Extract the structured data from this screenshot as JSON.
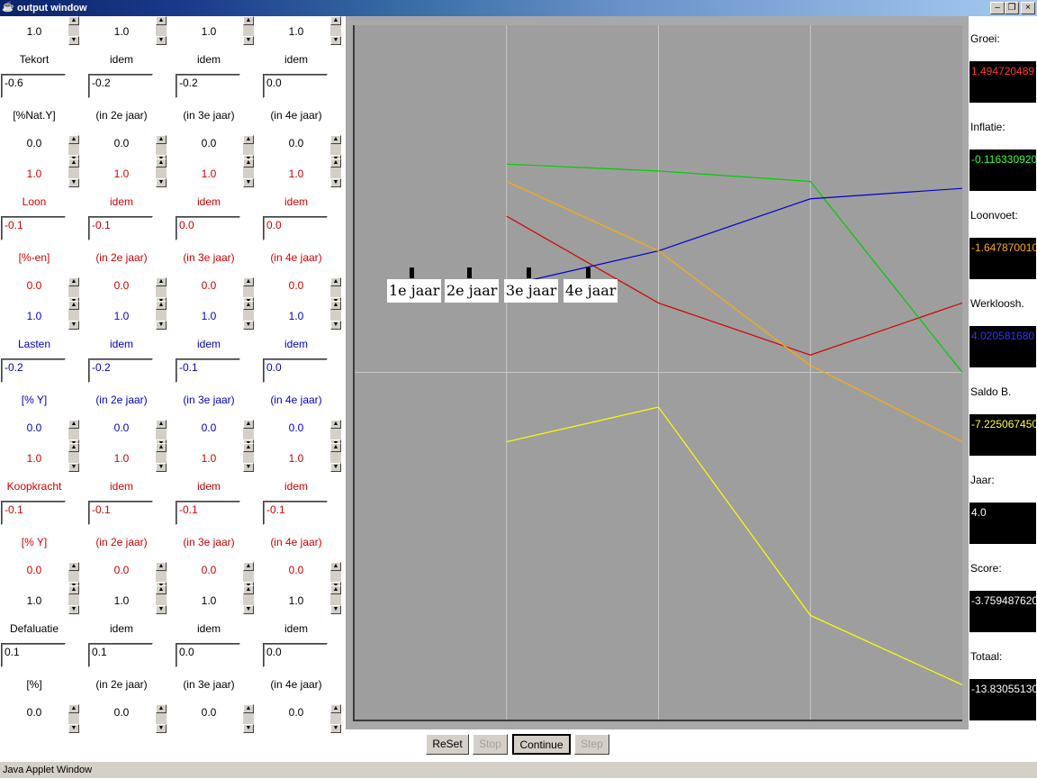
{
  "window": {
    "title": "output window",
    "status": "Java Applet Window"
  },
  "colors": {
    "black": "#000000",
    "red": "#d40000",
    "blue": "#0000cc",
    "green": "#00cc00",
    "orange": "#ffaa00",
    "yellow": "#ffff00",
    "white": "#ffffff"
  },
  "columns": [
    {
      "rows": [
        "1.0",
        "Tekort",
        "-0.6",
        "[%Nat.Y]",
        "0.0",
        "1.0",
        "Loon",
        "-0.1",
        "[%-en]",
        "0.0",
        "1.0",
        "Lasten",
        "-0.2",
        "[% Y]",
        "0.0",
        "1.0",
        "Koopkracht",
        "-0.1",
        "[% Y]",
        "0.0",
        "1.0",
        "Defaluatie",
        "0.1",
        "[%]",
        "0.0"
      ]
    },
    {
      "rows": [
        "1.0",
        "idem",
        "-0.2",
        "(in 2e jaar)",
        "0.0",
        "1.0",
        "idem",
        "-0.1",
        "(in 2e jaar)",
        "0.0",
        "1.0",
        "idem",
        "-0.2",
        "(in 2e jaar)",
        "0.0",
        "1.0",
        "idem",
        "-0.1",
        "(in 2e jaar)",
        "0.0",
        "1.0",
        "idem",
        "0.1",
        "(in 2e jaar)",
        "0.0"
      ]
    },
    {
      "rows": [
        "1.0",
        "idem",
        "-0.2",
        "(in 3e jaar)",
        "0.0",
        "1.0",
        "idem",
        "0.0",
        "(in 3e jaar)",
        "0.0",
        "1.0",
        "idem",
        "-0.1",
        "(in 3e jaar)",
        "0.0",
        "1.0",
        "idem",
        "-0.1",
        "(in 3e jaar)",
        "0.0",
        "1.0",
        "idem",
        "0.0",
        "(in 3e jaar)",
        "0.0"
      ]
    },
    {
      "rows": [
        "1.0",
        "idem",
        "0.0",
        "(in 4e jaar)",
        "0.0",
        "1.0",
        "idem",
        "0.0",
        "(in 4e jaar)",
        "0.0",
        "1.0",
        "idem",
        "0.0",
        "(in 4e jaar)",
        "0.0",
        "1.0",
        "idem",
        "-0.1",
        "(in 4e jaar)",
        "0.0",
        "1.0",
        "idem",
        "0.0",
        "(in 4e jaar)",
        "0.0"
      ]
    }
  ],
  "group_colors": [
    "black",
    "red",
    "blue",
    "red",
    "black"
  ],
  "chart_data": {
    "type": "line",
    "x": [
      "1e jaar",
      "2e jaar",
      "3e jaar",
      "4e jaar"
    ],
    "series": [
      {
        "color": "#d40000",
        "values": [
          0.45,
          0.2,
          0.05,
          0.2
        ]
      },
      {
        "color": "#00cc00",
        "values": [
          0.6,
          0.58,
          0.55,
          0.0
        ]
      },
      {
        "color": "#0000cc",
        "values": [
          0.25,
          0.35,
          0.5,
          0.53
        ]
      },
      {
        "color": "#ffaa00",
        "values": [
          0.55,
          0.35,
          0.02,
          -0.2
        ]
      },
      {
        "color": "#ffff00",
        "values": [
          -0.2,
          -0.1,
          -0.7,
          -0.9
        ]
      }
    ],
    "xlabel": "",
    "ylabel": ""
  },
  "legend_labels": [
    "1e jaar",
    "2e jaar",
    "3e jaar",
    "4e jaar"
  ],
  "readouts": [
    {
      "label": "Groei:",
      "value": "1.494720489",
      "color": "#ff3333"
    },
    {
      "label": "Inflatie:",
      "value": "-0.116330920",
      "color": "#33ff33"
    },
    {
      "label": "Loonvoet:",
      "value": "-1.647870010",
      "color": "#ffaa00"
    },
    {
      "label": "Werkloosh.",
      "value": "4.020581680",
      "color": "#3333ff"
    },
    {
      "label": "Saldo B.",
      "value": "-7.225067450",
      "color": "#ffff33"
    },
    {
      "label": "Jaar:",
      "value": "4.0",
      "color": "#ffffff"
    },
    {
      "label": "Score:",
      "value": "-3.759487620",
      "color": "#ffffff"
    },
    {
      "label": "Totaal:",
      "value": "-13.830551300",
      "color": "#ffffff"
    }
  ],
  "buttons": {
    "reset": "ReSet",
    "stop": "Stop",
    "continue": "Continue",
    "step": "Step"
  }
}
